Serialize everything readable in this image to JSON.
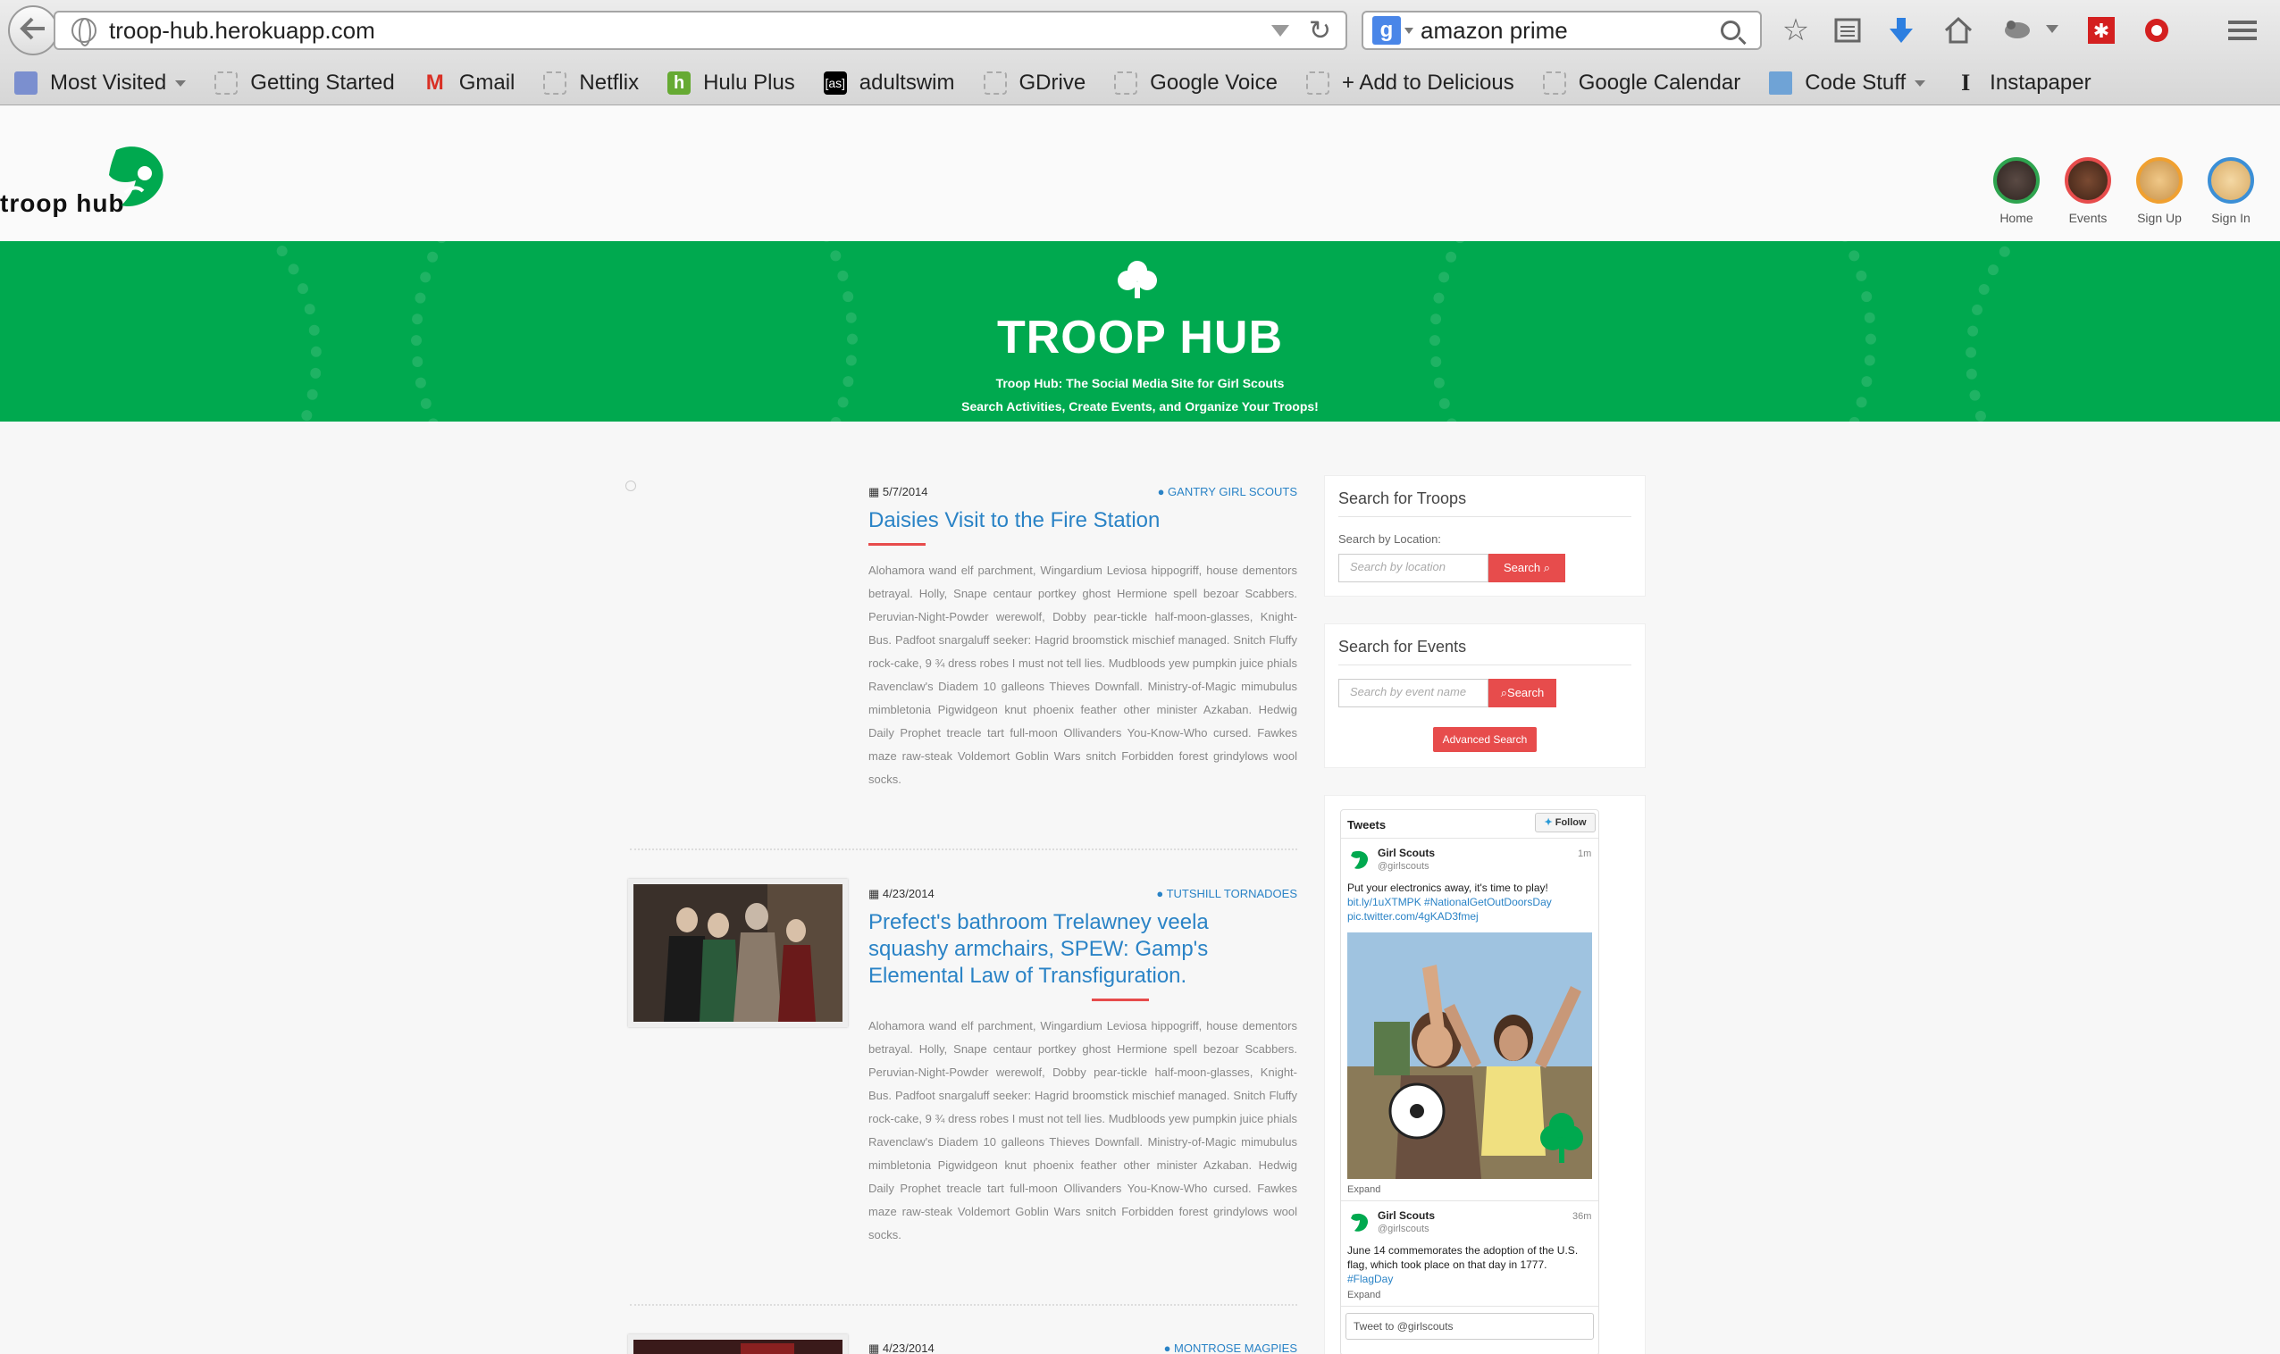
{
  "browser": {
    "url": "troop-hub.herokuapp.com",
    "search_query": "amazon prime",
    "bookmarks": [
      {
        "label": "Most Visited"
      },
      {
        "label": "Getting Started"
      },
      {
        "label": "Gmail"
      },
      {
        "label": "Netflix"
      },
      {
        "label": "Hulu Plus"
      },
      {
        "label": "adultswim"
      },
      {
        "label": "GDrive"
      },
      {
        "label": "Google Voice"
      },
      {
        "label": "+ Add to Delicious"
      },
      {
        "label": "Google Calendar"
      },
      {
        "label": "Code Stuff"
      },
      {
        "label": "Instapaper"
      }
    ]
  },
  "site": {
    "logo_text": "troop hub",
    "nav": [
      {
        "label": "Home",
        "color": "#2ea44f"
      },
      {
        "label": "Events",
        "color": "#e74c4c"
      },
      {
        "label": "Sign Up",
        "color": "#f0a030"
      },
      {
        "label": "Sign In",
        "color": "#3b8fd6"
      }
    ],
    "banner": {
      "title": "TROOP HUB",
      "subtitle1": "Troop Hub: The Social Media Site for Girl Scouts",
      "subtitle2": "Search Activities, Create Events, and Organize Your Troops!"
    }
  },
  "posts": [
    {
      "date": "5/7/2014",
      "group": "GANTRY GIRL SCOUTS",
      "title": "Daisies Visit to the Fire Station",
      "body": "Alohamora wand elf parchment, Wingardium Leviosa hippogriff, house dementors betrayal. Holly, Snape centaur portkey ghost Hermione spell bezoar Scabbers. Peruvian-Night-Powder werewolf, Dobby pear-tickle half-moon-glasses, Knight-Bus. Padfoot snargaluff seeker: Hagrid broomstick mischief managed. Snitch Fluffy rock-cake, 9 ¾ dress robes I must not tell lies. Mudbloods yew pumpkin juice phials Ravenclaw's Diadem 10 galleons Thieves Downfall. Ministry-of-Magic mimubulus mimbletonia Pigwidgeon knut phoenix feather other minister Azkaban. Hedwig Daily Prophet treacle tart full-moon Ollivanders You-Know-Who cursed. Fawkes maze raw-steak Voldemort Goblin Wars snitch Forbidden forest grindylows wool socks."
    },
    {
      "date": "4/23/2014",
      "group": "TUTSHILL TORNADOES",
      "title": "Prefect's bathroom Trelawney veela squashy armchairs, SPEW: Gamp's Elemental Law of Transfiguration.",
      "body": "Alohamora wand elf parchment, Wingardium Leviosa hippogriff, house dementors betrayal. Holly, Snape centaur portkey ghost Hermione spell bezoar Scabbers. Peruvian-Night-Powder werewolf, Dobby pear-tickle half-moon-glasses, Knight-Bus. Padfoot snargaluff seeker: Hagrid broomstick mischief managed. Snitch Fluffy rock-cake, 9 ¾ dress robes I must not tell lies. Mudbloods yew pumpkin juice phials Ravenclaw's Diadem 10 galleons Thieves Downfall. Ministry-of-Magic mimubulus mimbletonia Pigwidgeon knut phoenix feather other minister Azkaban. Hedwig Daily Prophet treacle tart full-moon Ollivanders You-Know-Who cursed. Fawkes maze raw-steak Voldemort Goblin Wars snitch Forbidden forest grindylows wool socks."
    },
    {
      "date": "4/23/2014",
      "group": "MONTROSE MAGPIES"
    }
  ],
  "sidebar": {
    "troops": {
      "title": "Search for Troops",
      "label": "Search by Location:",
      "placeholder": "Search by location",
      "button": "Search"
    },
    "events": {
      "title": "Search for Events",
      "placeholder": "Search by event name",
      "button": "Search",
      "advanced": "Advanced Search"
    },
    "tweets": {
      "title": "Tweets",
      "follow": "Follow",
      "items": [
        {
          "name": "Girl Scouts",
          "handle": "@girlscouts",
          "time": "1m",
          "text": "Put your electronics away, it's time to play!",
          "link1": "bit.ly/1uXTMPK #NationalGetOutDoorsDay",
          "link2": "pic.twitter.com/4gKAD3fmej",
          "expand": "Expand"
        },
        {
          "name": "Girl Scouts",
          "handle": "@girlscouts",
          "time": "36m",
          "text": "June 14 commemorates the adoption of the U.S. flag, which took place on that day in 1777.",
          "link1": "#FlagDay",
          "expand": "Expand"
        }
      ],
      "compose_placeholder": "Tweet to @girlscouts"
    }
  }
}
